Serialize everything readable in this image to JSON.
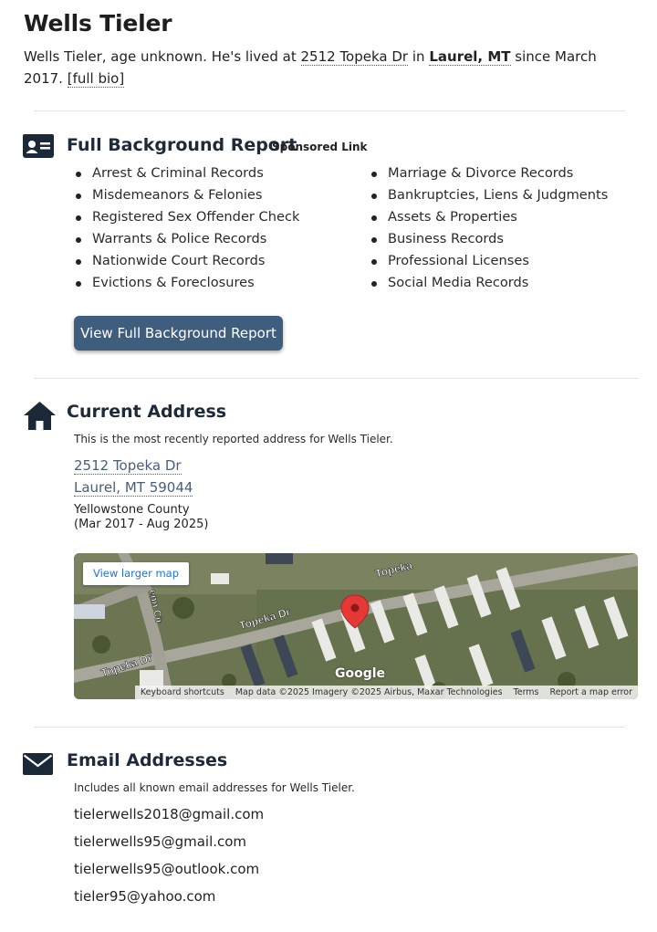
{
  "person": {
    "name": "Wells Tieler",
    "intro_prefix": "Wells Tieler, age unknown. He's lived at",
    "intro_address": "2512 Topeka Dr",
    "intro_in": "in",
    "intro_city": "Laurel, MT",
    "intro_since": "since March 2017.",
    "full_bio_link": "[full bio]"
  },
  "background_report": {
    "title": "Full Background Report",
    "sponsored_label": "Sponsored Link",
    "left_items": [
      "Arrest & Criminal Records",
      "Misdemeanors & Felonies",
      "Registered Sex Offender Check",
      "Warrants & Police Records",
      "Nationwide Court Records",
      "Evictions & Foreclosures"
    ],
    "right_items": [
      "Marriage & Divorce Records",
      "Bankruptcies, Liens & Judgments",
      "Assets & Properties",
      "Business Records",
      "Professional Licenses",
      "Social Media Records"
    ],
    "button_label": "View Full Background Report"
  },
  "current_address": {
    "title": "Current Address",
    "note": "This is the most recently reported address for Wells Tieler.",
    "street": "2512 Topeka Dr",
    "city_line": "Laurel, MT 59044",
    "county": "Yellowstone County",
    "dates": "(Mar 2017 - Aug 2025)",
    "map": {
      "view_larger": "View larger map",
      "google": "Google",
      "keyboard_shortcuts": "Keyboard shortcuts",
      "map_data": "Map data ©2025 Imagery ©2025 Airbus, Maxar Technologies",
      "terms": "Terms",
      "report_error": "Report a map error",
      "street_labels": [
        "Topeka Dr",
        "Topeka Dr",
        "Topeka",
        "enn Cir"
      ]
    }
  },
  "email_addresses": {
    "title": "Email Addresses",
    "note": "Includes all known email addresses for Wells Tieler.",
    "emails": [
      "tielerwells2018@gmail.com",
      "tielerwells95@gmail.com",
      "tielerwells95@outlook.com",
      "tieler95@yahoo.com"
    ]
  },
  "colors": {
    "button_bg": "#3f5d7c",
    "icon": "#1b2838",
    "link": "#4a5e78",
    "pin": "#e53935"
  }
}
